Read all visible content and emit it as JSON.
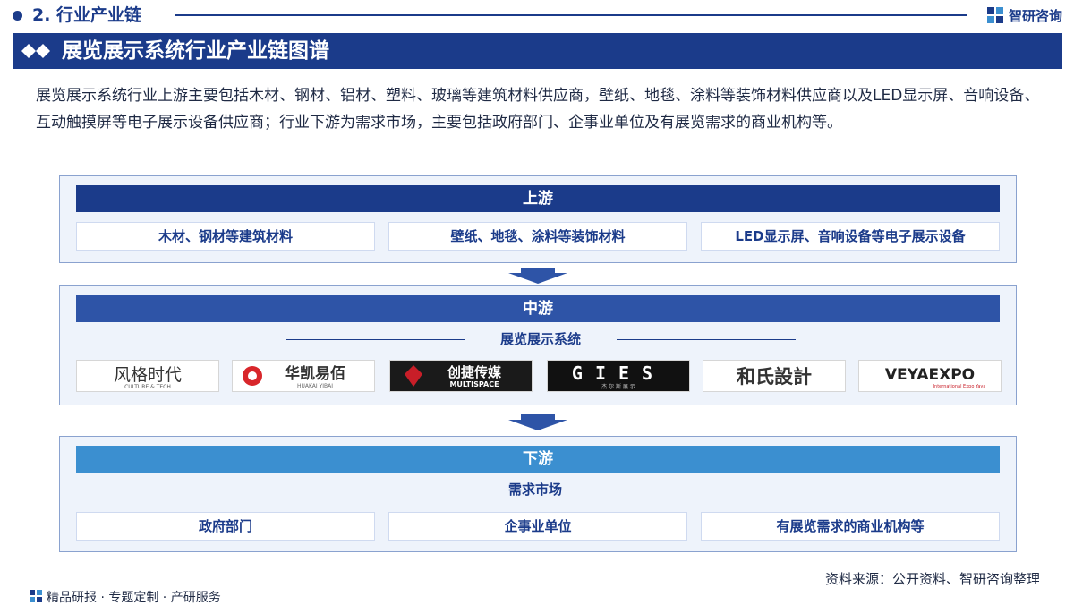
{
  "header": {
    "section": "2. 行业产业链",
    "brand": "智研咨询"
  },
  "banner": {
    "title": "展览展示系统行业产业链图谱"
  },
  "intro": "展览展示系统行业上游主要包括木材、钢材、铝材、塑料、玻璃等建筑材料供应商，壁纸、地毯、涂料等装饰材料供应商以及LED显示屏、音响设备、互动触摸屏等电子展示设备供应商；行业下游为需求市场，主要包括政府部门、企事业单位及有展览需求的商业机构等。",
  "upstream": {
    "label": "上游",
    "items": [
      "木材、钢材等建筑材料",
      "壁纸、地毯、涂料等装饰材料",
      "LED显示屏、音响设备等电子展示设备"
    ]
  },
  "midstream": {
    "label": "中游",
    "subtitle": "展览展示系统",
    "logos": [
      {
        "name": "风格时代",
        "sub": "CULTURE & TECH"
      },
      {
        "name": "华凯易佰",
        "sub": "HUAKAI YIBAI"
      },
      {
        "name": "创捷传媒",
        "sub": "MULTISPACE"
      },
      {
        "name": "GIES",
        "sub": "杰 尔 斯 展 示"
      },
      {
        "name": "和氏設計",
        "sub": ""
      },
      {
        "name": "VEYAEXPO",
        "sub": "International Expo Yaya"
      }
    ]
  },
  "downstream": {
    "label": "下游",
    "subtitle": "需求市场",
    "items": [
      "政府部门",
      "企事业单位",
      "有展览需求的商业机构等"
    ]
  },
  "footer": {
    "source": "资料来源：公开资料、智研咨询整理",
    "slogan": "精品研报 · 专题定制 · 产研服务"
  },
  "colors": {
    "navy": "#1b3b8a",
    "mid_blue": "#2e54a7",
    "light_blue": "#3b8fd0"
  }
}
